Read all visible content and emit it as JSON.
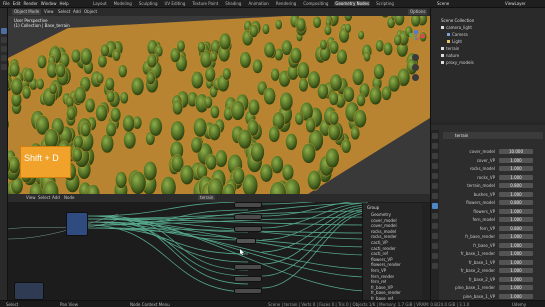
{
  "topbar": {
    "menu": [
      "File",
      "Edit",
      "Render",
      "Window",
      "Help"
    ],
    "tabs": [
      "Layout",
      "Modeling",
      "Sculpting",
      "UV Editing",
      "Texture Paint",
      "Shading",
      "Animation",
      "Rendering",
      "Compositing",
      "Geometry Nodes",
      "Scripting"
    ],
    "active_tab": "Geometry Nodes",
    "scene": "Scene",
    "view_layer": "ViewLayer"
  },
  "viewport": {
    "mode": "Object Mode",
    "menu": [
      "View",
      "Select",
      "Add",
      "Object"
    ],
    "overlay_title": "User Perspective",
    "overlay_sub": "(1) Collection | Base_terrain",
    "options_label": "Options",
    "shortcut_key": "Shift + D"
  },
  "node_editor": {
    "menu": [
      "View",
      "Select",
      "Add",
      "Node"
    ],
    "tree_name": "terrain",
    "sidebar_title": "Group",
    "sidebar_items": [
      "Geometry",
      "cover_model",
      "cover_model",
      "rocks_model",
      "rocks_render",
      "cacti_VP",
      "cacti_render",
      "cacti_ref",
      "flowers_VP",
      "flowers_render",
      "fern_VP",
      "fern_render",
      "fern_ref",
      "fr_base_VP",
      "fr_base_render",
      "fr_base_ref",
      "fr_base_1_VP"
    ]
  },
  "outliner": {
    "title": "Scene Collection",
    "items": [
      "camera_light",
      "Camera",
      "Light",
      "terrain",
      "nature",
      "proxy_models"
    ]
  },
  "properties": {
    "object_name": "terrain",
    "rows": [
      {
        "label": "cover_model",
        "value": "10.000"
      },
      {
        "label": "cover_VP",
        "value": "1.000"
      },
      {
        "label": "rocks_model",
        "value": "1.000"
      },
      {
        "label": "rocks_VP",
        "value": "1.000"
      },
      {
        "label": "terrain_model",
        "value": "0.800"
      },
      {
        "label": "bushes_VP",
        "value": "1.000"
      },
      {
        "label": "flowers_model",
        "value": "0.800"
      },
      {
        "label": "flowers_VP",
        "value": "1.000"
      },
      {
        "label": "fern_model",
        "value": "1.000"
      },
      {
        "label": "fern_VP",
        "value": "0.800"
      },
      {
        "label": "fr_base_render",
        "value": "1.000"
      },
      {
        "label": "fr_base_VP",
        "value": "1.000"
      },
      {
        "label": "fr_base_1_render",
        "value": "1.000"
      },
      {
        "label": "fr_base_1_VP",
        "value": "1.000"
      },
      {
        "label": "fr_base_2_render",
        "value": "1.000"
      },
      {
        "label": "fr_base_2_VP",
        "value": "1.000"
      },
      {
        "label": "pine_base_1_render",
        "value": "1.000"
      },
      {
        "label": "pine_base_1_VP",
        "value": "1.000"
      },
      {
        "label": "fr_base_1",
        "value": "1.000"
      }
    ]
  },
  "status": {
    "left": "Select",
    "mid": "Pan View",
    "right": "Node Context Menu",
    "info": "Scene | terrain | Verts 0 | Faces 0 | Tris 0 | Objects 1/6 | Memory: 1.7 GiB | VRAM: 0.8/24.0 GiB | 3.1.0"
  },
  "watermark": "Udemy",
  "colors": {
    "accent": "#f0a22a",
    "node_wire": "#5fbf9e",
    "foliage": "#5b7a2b",
    "ground": "#c48b2d"
  }
}
